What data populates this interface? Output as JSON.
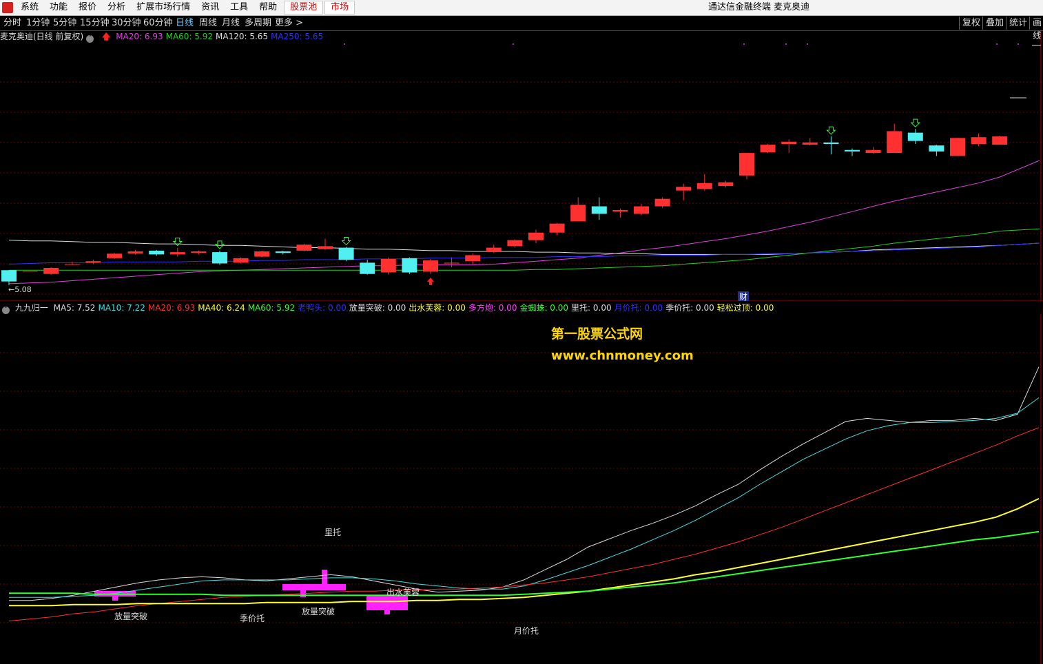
{
  "menubar": {
    "items": [
      "系统",
      "功能",
      "报价",
      "分析",
      "扩展市场行情",
      "资讯",
      "工具",
      "帮助"
    ],
    "red_items": [
      "股票池",
      "市场"
    ],
    "window_title": "通达信金融终端  麦克奥迪"
  },
  "periodbar": {
    "items": [
      "分时",
      "1分钟",
      "5分钟",
      "15分钟",
      "30分钟",
      "60分钟",
      "日线",
      "周线",
      "月线",
      "多周期",
      "更多 >"
    ],
    "active": "日线",
    "right_buttons": [
      "复权",
      "叠加",
      "统计",
      "画线"
    ]
  },
  "main_legend": {
    "title": "麦克奥迪(日线 前复权)",
    "ma": [
      {
        "label": "MA20: 6.93",
        "color": "#e040e0"
      },
      {
        "label": "MA60: 5.92",
        "color": "#20d020"
      },
      {
        "label": "MA120: 5.65",
        "color": "#dddddd"
      },
      {
        "label": "MA250: 5.65",
        "color": "#3030ff"
      }
    ],
    "low_label": "5.08",
    "finance_badge": "财"
  },
  "sub_legend": {
    "title": "九九归一",
    "items": [
      {
        "label": "MA5: 7.52",
        "color": "#dddddd"
      },
      {
        "label": "MA10: 7.22",
        "color": "#40e0e0"
      },
      {
        "label": "MA20: 6.93",
        "color": "#ff3030"
      },
      {
        "label": "MA40: 6.24",
        "color": "#ffff30"
      },
      {
        "label": "MA60: 5.92",
        "color": "#30ff30"
      },
      {
        "label": "老鸭头: 0.00",
        "color": "#3030ff"
      },
      {
        "label": "放量突破: 0.00",
        "color": "#dddddd"
      },
      {
        "label": "出水芙蓉: 0.00",
        "color": "#ffff30"
      },
      {
        "label": "多方炮: 0.00",
        "color": "#ff40ff"
      },
      {
        "label": "金蜘蛛: 0.00",
        "color": "#30ff30"
      },
      {
        "label": "里托: 0.00",
        "color": "#dddddd"
      },
      {
        "label": "月价托: 0.00",
        "color": "#3030ff"
      },
      {
        "label": "季价托: 0.00",
        "color": "#dddddd"
      },
      {
        "label": "轻松过顶: 0.00",
        "color": "#ffff30"
      }
    ]
  },
  "annotations": {
    "li_tuo": "里托",
    "fangliang_1": "放量突破",
    "ji_jia_tuo": "季价托",
    "fangliang_2": "放量突破",
    "chushui": "出水芙蓉",
    "yue_jia_tuo": "月价托"
  },
  "watermark": {
    "line1": "第一股票公式网",
    "line2": "www.chnmoney.com"
  },
  "colors": {
    "up": "#ff3030",
    "down": "#50f0f0",
    "grid": "#7a0000"
  },
  "chart_data": {
    "type": "candlestick",
    "price_range": [
      5.0,
      8.3
    ],
    "candles": [
      {
        "o": 5.3,
        "c": 5.15,
        "h": 5.3,
        "l": 5.1
      },
      {
        "o": 5.29,
        "c": 5.29,
        "h": 5.29,
        "l": 5.29
      },
      {
        "o": 5.25,
        "c": 5.33,
        "h": 5.34,
        "l": 5.24
      },
      {
        "o": 5.38,
        "c": 5.38,
        "h": 5.41,
        "l": 5.37
      },
      {
        "o": 5.4,
        "c": 5.42,
        "h": 5.44,
        "l": 5.38
      },
      {
        "o": 5.46,
        "c": 5.52,
        "h": 5.53,
        "l": 5.45
      },
      {
        "o": 5.52,
        "c": 5.55,
        "h": 5.57,
        "l": 5.51
      },
      {
        "o": 5.56,
        "c": 5.51,
        "h": 5.57,
        "l": 5.49
      },
      {
        "o": 5.51,
        "c": 5.54,
        "h": 5.6,
        "l": 5.48
      },
      {
        "o": 5.53,
        "c": 5.55,
        "h": 5.56,
        "l": 5.51
      },
      {
        "o": 5.54,
        "c": 5.39,
        "h": 5.56,
        "l": 5.37
      },
      {
        "o": 5.4,
        "c": 5.46,
        "h": 5.47,
        "l": 5.39
      },
      {
        "o": 5.48,
        "c": 5.55,
        "h": 5.56,
        "l": 5.47
      },
      {
        "o": 5.55,
        "c": 5.53,
        "h": 5.56,
        "l": 5.51
      },
      {
        "o": 5.56,
        "c": 5.64,
        "h": 5.65,
        "l": 5.55
      },
      {
        "o": 5.58,
        "c": 5.62,
        "h": 5.72,
        "l": 5.57
      },
      {
        "o": 5.6,
        "c": 5.44,
        "h": 5.61,
        "l": 5.42
      },
      {
        "o": 5.4,
        "c": 5.25,
        "h": 5.44,
        "l": 5.24
      },
      {
        "o": 5.27,
        "c": 5.45,
        "h": 5.47,
        "l": 5.24
      },
      {
        "o": 5.46,
        "c": 5.27,
        "h": 5.47,
        "l": 5.25
      },
      {
        "o": 5.28,
        "c": 5.43,
        "h": 5.45,
        "l": 5.25
      },
      {
        "o": 5.39,
        "c": 5.4,
        "h": 5.47,
        "l": 5.34
      },
      {
        "o": 5.42,
        "c": 5.5,
        "h": 5.52,
        "l": 5.38
      },
      {
        "o": 5.55,
        "c": 5.6,
        "h": 5.64,
        "l": 5.53
      },
      {
        "o": 5.62,
        "c": 5.7,
        "h": 5.71,
        "l": 5.6
      },
      {
        "o": 5.7,
        "c": 5.8,
        "h": 5.84,
        "l": 5.66
      },
      {
        "o": 5.8,
        "c": 5.92,
        "h": 5.93,
        "l": 5.77
      },
      {
        "o": 5.95,
        "c": 6.17,
        "h": 6.27,
        "l": 5.95
      },
      {
        "o": 6.15,
        "c": 6.05,
        "h": 6.27,
        "l": 5.97
      },
      {
        "o": 6.08,
        "c": 6.1,
        "h": 6.12,
        "l": 6.0
      },
      {
        "o": 6.05,
        "c": 6.15,
        "h": 6.18,
        "l": 6.03
      },
      {
        "o": 6.15,
        "c": 6.25,
        "h": 6.27,
        "l": 6.13
      },
      {
        "o": 6.36,
        "c": 6.41,
        "h": 6.45,
        "l": 6.23
      },
      {
        "o": 6.38,
        "c": 6.46,
        "h": 6.58,
        "l": 6.36
      },
      {
        "o": 6.42,
        "c": 6.47,
        "h": 6.49,
        "l": 6.4
      },
      {
        "o": 6.56,
        "c": 6.86,
        "h": 6.86,
        "l": 6.51
      },
      {
        "o": 6.87,
        "c": 6.97,
        "h": 6.98,
        "l": 6.86
      },
      {
        "o": 6.98,
        "c": 7.01,
        "h": 7.04,
        "l": 6.86
      },
      {
        "o": 6.97,
        "c": 7.0,
        "h": 7.06,
        "l": 6.96
      },
      {
        "o": 7.0,
        "c": 6.98,
        "h": 7.08,
        "l": 6.84
      },
      {
        "o": 6.9,
        "c": 6.88,
        "h": 6.92,
        "l": 6.82
      },
      {
        "o": 6.86,
        "c": 6.9,
        "h": 6.94,
        "l": 6.85
      },
      {
        "o": 6.86,
        "c": 7.15,
        "h": 7.25,
        "l": 6.86
      },
      {
        "o": 7.13,
        "c": 7.02,
        "h": 7.18,
        "l": 6.98
      },
      {
        "o": 6.96,
        "c": 6.88,
        "h": 6.97,
        "l": 6.82
      },
      {
        "o": 6.82,
        "c": 7.06,
        "h": 7.06,
        "l": 6.82
      },
      {
        "o": 6.98,
        "c": 7.07,
        "h": 7.12,
        "l": 6.95
      },
      {
        "o": 6.97,
        "c": 7.08,
        "h": 7.09,
        "l": 6.97
      }
    ],
    "ma_lines": {
      "MA20": [
        5.12,
        5.13,
        5.14,
        5.16,
        5.18,
        5.2,
        5.22,
        5.24,
        5.26,
        5.28,
        5.29,
        5.3,
        5.31,
        5.32,
        5.33,
        5.34,
        5.35,
        5.36,
        5.36,
        5.37,
        5.37,
        5.37,
        5.37,
        5.38,
        5.4,
        5.42,
        5.44,
        5.46,
        5.5,
        5.53,
        5.57,
        5.6,
        5.64,
        5.68,
        5.72,
        5.77,
        5.82,
        5.88,
        5.94,
        6.01,
        6.08,
        6.15,
        6.22,
        6.28,
        6.34,
        6.4,
        6.46,
        6.54
      ],
      "MA60": [
        5.3,
        5.3,
        5.3,
        5.3,
        5.3,
        5.3,
        5.3,
        5.3,
        5.3,
        5.3,
        5.3,
        5.3,
        5.3,
        5.3,
        5.3,
        5.3,
        5.3,
        5.3,
        5.3,
        5.3,
        5.3,
        5.3,
        5.3,
        5.3,
        5.3,
        5.31,
        5.31,
        5.32,
        5.33,
        5.34,
        5.35,
        5.36,
        5.38,
        5.4,
        5.42,
        5.44,
        5.47,
        5.5,
        5.53,
        5.56,
        5.59,
        5.62,
        5.66,
        5.69,
        5.72,
        5.75,
        5.78,
        5.82
      ],
      "MA120": [
        5.7,
        5.69,
        5.69,
        5.68,
        5.67,
        5.67,
        5.66,
        5.65,
        5.65,
        5.64,
        5.63,
        5.63,
        5.62,
        5.61,
        5.6,
        5.6,
        5.59,
        5.58,
        5.58,
        5.57,
        5.56,
        5.56,
        5.55,
        5.55,
        5.55,
        5.54,
        5.54,
        5.53,
        5.53,
        5.52,
        5.52,
        5.51,
        5.51,
        5.51,
        5.51,
        5.51,
        5.51,
        5.52,
        5.53,
        5.54,
        5.55,
        5.57,
        5.58,
        5.59,
        5.6,
        5.61,
        5.62,
        5.63
      ],
      "MA250": [
        5.38,
        5.39,
        5.4,
        5.4,
        5.4,
        5.41,
        5.41,
        5.41,
        5.41,
        5.42,
        5.42,
        5.42,
        5.43,
        5.43,
        5.44,
        5.44,
        5.44,
        5.45,
        5.45,
        5.45,
        5.46,
        5.46,
        5.46,
        5.47,
        5.47,
        5.47,
        5.48,
        5.48,
        5.48,
        5.49,
        5.49,
        5.5,
        5.5,
        5.5,
        5.51,
        5.51,
        5.52,
        5.52,
        5.53,
        5.54,
        5.55,
        5.56,
        5.57,
        5.58,
        5.59,
        5.6,
        5.61,
        5.63
      ]
    },
    "sub_range": [
      4.9,
      7.9
    ],
    "sub_lines": {
      "MA5": [
        5.25,
        5.25,
        5.27,
        5.3,
        5.34,
        5.38,
        5.42,
        5.45,
        5.47,
        5.48,
        5.47,
        5.45,
        5.44,
        5.46,
        5.48,
        5.5,
        5.48,
        5.44,
        5.4,
        5.36,
        5.33,
        5.34,
        5.35,
        5.38,
        5.45,
        5.55,
        5.65,
        5.77,
        5.85,
        5.93,
        6.0,
        6.08,
        6.17,
        6.28,
        6.38,
        6.52,
        6.65,
        6.77,
        6.88,
        6.99,
        7.02,
        7.0,
        6.98,
        7.0,
        7.0,
        7.02,
        7.0,
        7.06,
        7.52
      ],
      "MA10": [
        5.28,
        5.28,
        5.28,
        5.29,
        5.3,
        5.32,
        5.35,
        5.38,
        5.41,
        5.44,
        5.45,
        5.45,
        5.45,
        5.45,
        5.46,
        5.47,
        5.47,
        5.46,
        5.44,
        5.41,
        5.39,
        5.37,
        5.36,
        5.36,
        5.39,
        5.45,
        5.52,
        5.59,
        5.67,
        5.75,
        5.84,
        5.93,
        6.03,
        6.14,
        6.25,
        6.38,
        6.5,
        6.62,
        6.72,
        6.82,
        6.9,
        6.95,
        6.98,
        6.98,
        6.99,
        7.0,
        7.02,
        7.07,
        7.22
      ],
      "MA20": [
        5.05,
        5.07,
        5.09,
        5.12,
        5.14,
        5.17,
        5.2,
        5.22,
        5.24,
        5.26,
        5.28,
        5.29,
        5.3,
        5.31,
        5.32,
        5.33,
        5.34,
        5.34,
        5.35,
        5.35,
        5.36,
        5.36,
        5.37,
        5.38,
        5.4,
        5.42,
        5.45,
        5.48,
        5.52,
        5.56,
        5.6,
        5.65,
        5.7,
        5.76,
        5.82,
        5.89,
        5.96,
        6.04,
        6.12,
        6.2,
        6.28,
        6.36,
        6.44,
        6.52,
        6.6,
        6.68,
        6.76,
        6.85,
        6.93
      ],
      "MA40": [
        5.2,
        5.2,
        5.2,
        5.21,
        5.21,
        5.21,
        5.22,
        5.22,
        5.22,
        5.22,
        5.22,
        5.22,
        5.23,
        5.23,
        5.23,
        5.23,
        5.24,
        5.24,
        5.24,
        5.25,
        5.25,
        5.26,
        5.26,
        5.27,
        5.28,
        5.3,
        5.32,
        5.34,
        5.37,
        5.4,
        5.43,
        5.46,
        5.5,
        5.53,
        5.57,
        5.61,
        5.65,
        5.69,
        5.73,
        5.77,
        5.81,
        5.85,
        5.89,
        5.93,
        5.97,
        6.01,
        6.06,
        6.14,
        6.24
      ],
      "MA60": [
        5.32,
        5.32,
        5.32,
        5.32,
        5.31,
        5.31,
        5.31,
        5.31,
        5.31,
        5.31,
        5.3,
        5.3,
        5.3,
        5.3,
        5.3,
        5.3,
        5.3,
        5.3,
        5.3,
        5.3,
        5.3,
        5.3,
        5.3,
        5.3,
        5.31,
        5.32,
        5.33,
        5.34,
        5.36,
        5.38,
        5.4,
        5.42,
        5.45,
        5.48,
        5.51,
        5.54,
        5.57,
        5.6,
        5.63,
        5.66,
        5.69,
        5.72,
        5.75,
        5.78,
        5.81,
        5.84,
        5.86,
        5.89,
        5.92
      ]
    }
  }
}
